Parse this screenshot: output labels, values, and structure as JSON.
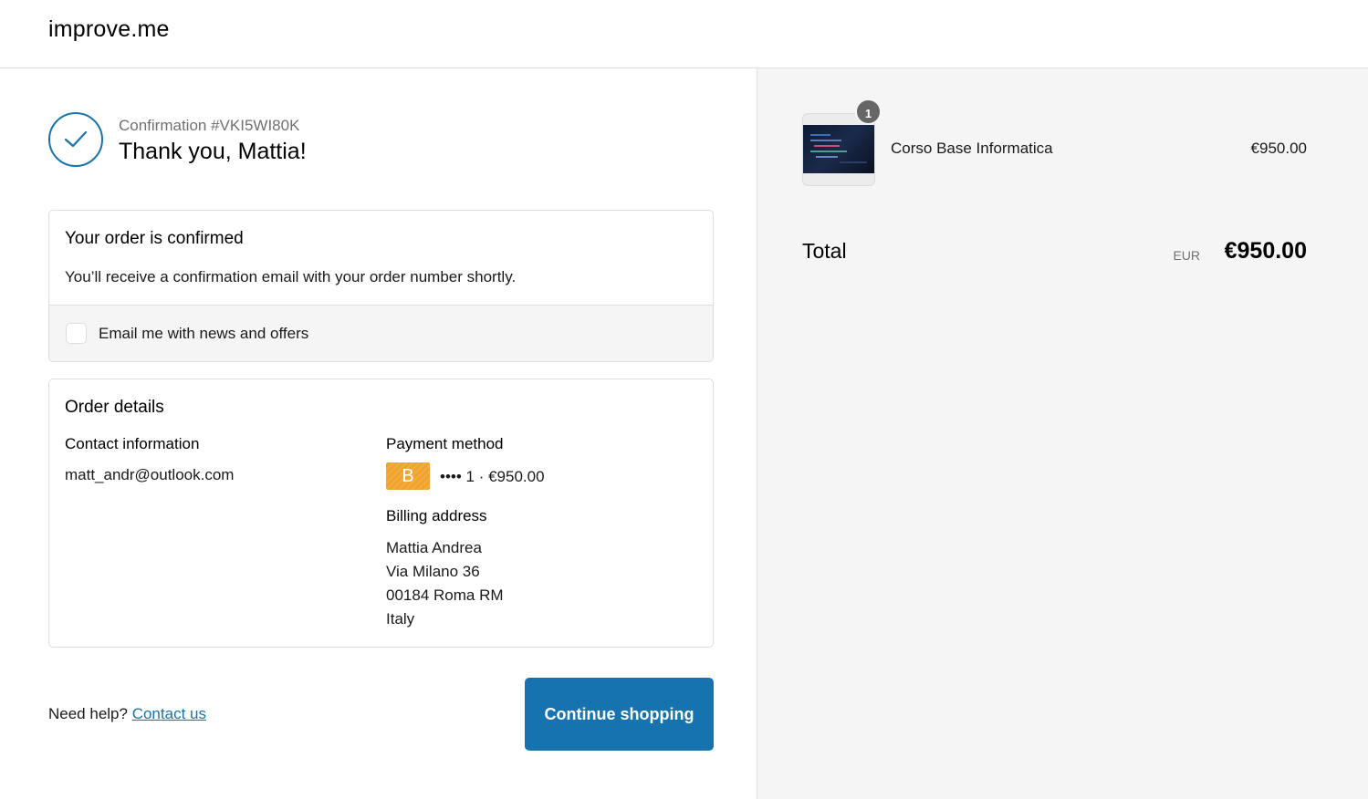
{
  "header": {
    "brand": "improve.me"
  },
  "confirmation": {
    "number": "Confirmation #VKI5WI80K",
    "heading": "Thank you, Mattia!"
  },
  "status_card": {
    "title": "Your order is confirmed",
    "description": "You’ll receive a confirmation email with your order number shortly.",
    "newsletter_label": "Email me with news and offers",
    "newsletter_checked": false
  },
  "details_card": {
    "title": "Order details",
    "contact_heading": "Contact information",
    "contact_email": "matt_andr@outlook.com",
    "payment_heading": "Payment method",
    "payment_badge": "B",
    "payment_summary": "•••• 1 · €950.00",
    "billing_heading": "Billing address",
    "billing_lines": [
      "Mattia Andrea",
      "Via Milano 36",
      "00184 Roma RM",
      "Italy"
    ]
  },
  "footer": {
    "help_text": "Need help?",
    "help_link": "Contact us",
    "continue_button": "Continue shopping"
  },
  "summary": {
    "item": {
      "quantity": "1",
      "name": "Corso Base Informatica",
      "price": "€950.00"
    },
    "total_label": "Total",
    "currency": "EUR",
    "total_amount": "€950.00"
  },
  "colors": {
    "accent": "#1773b0",
    "badge": "#f0a32b",
    "sidebar_bg": "#f5f5f5"
  }
}
